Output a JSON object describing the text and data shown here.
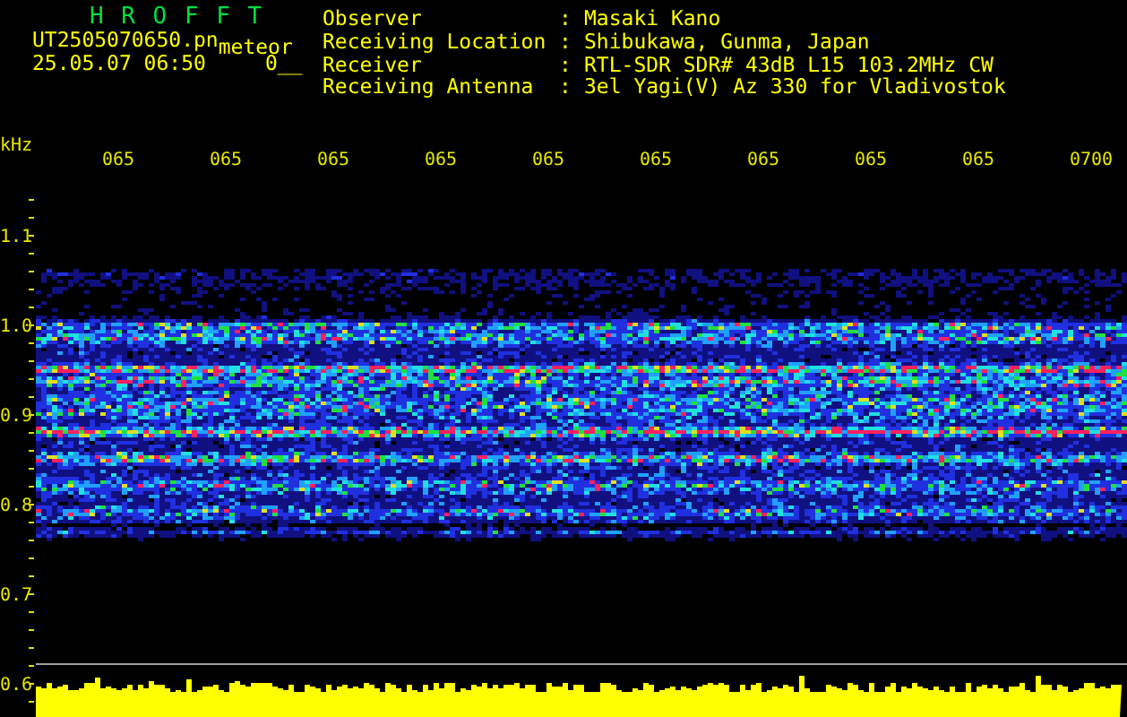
{
  "header": {
    "title": "H R O F F T",
    "file_name": "UT2505070650.pn",
    "file_suffix": "meteor",
    "date_time": "25.05.07 06:50",
    "code": "0__"
  },
  "info": [
    {
      "label": "Observer",
      "separator": ":",
      "value": "Masaki Kano"
    },
    {
      "label": "Receiving Location",
      "separator": ":",
      "value": "Shibukawa, Gunma, Japan"
    },
    {
      "label": "Receiver",
      "separator": ":",
      "value": "RTL-SDR SDR# 43dB L15 103.2MHz CW"
    },
    {
      "label": "Receiving Antenna",
      "separator": ":",
      "value": "3el Yagi(V) Az 330 for Vladivostok"
    }
  ],
  "plot": {
    "freq_unit": "kHz",
    "time_labels": [
      "065",
      "065",
      "065",
      "065",
      "065",
      "065",
      "065",
      "065",
      "065",
      "0700"
    ],
    "freq_labels": [
      "1.1",
      "1.0",
      "0.9",
      "0.8",
      "0.7",
      "0.6"
    ]
  }
}
